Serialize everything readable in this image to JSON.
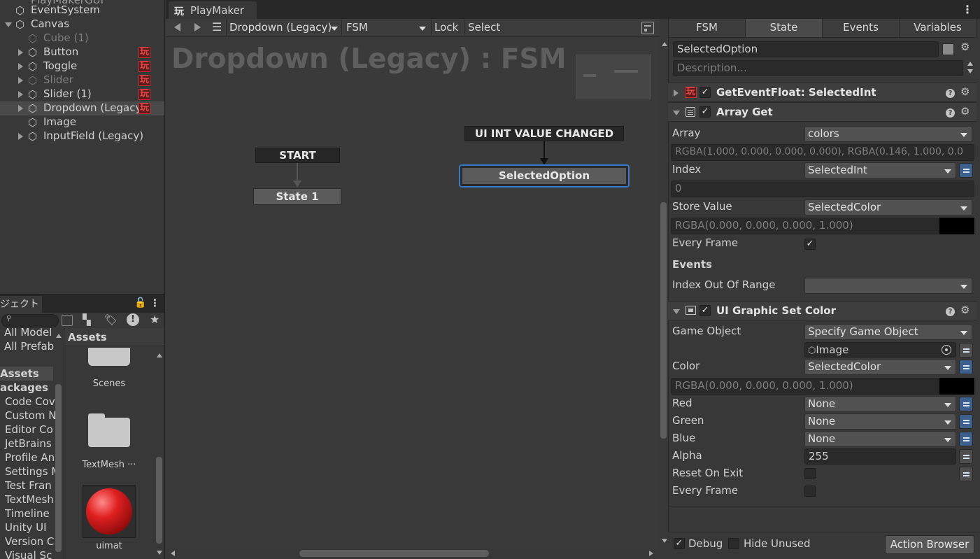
{
  "hierarchy": {
    "items": [
      {
        "label": "EventSystem",
        "indent": 0,
        "arrow": "",
        "dim": false,
        "pm": false
      },
      {
        "label": "Canvas",
        "indent": 0,
        "arrow": "down",
        "dim": false,
        "pm": false
      },
      {
        "label": "Cube (1)",
        "indent": 1,
        "arrow": "",
        "dim": true,
        "pm": false
      },
      {
        "label": "Button",
        "indent": 1,
        "arrow": "right",
        "dim": false,
        "pm": true
      },
      {
        "label": "Toggle",
        "indent": 1,
        "arrow": "right",
        "dim": false,
        "pm": true
      },
      {
        "label": "Slider",
        "indent": 1,
        "arrow": "right",
        "dim": true,
        "pm": true
      },
      {
        "label": "Slider (1)",
        "indent": 1,
        "arrow": "right",
        "dim": false,
        "pm": true
      },
      {
        "label": "Dropdown (Legacy)",
        "indent": 1,
        "arrow": "right",
        "dim": false,
        "pm": true
      },
      {
        "label": "Image",
        "indent": 1,
        "arrow": "",
        "dim": false,
        "pm": false
      },
      {
        "label": "InputField (Legacy)",
        "indent": 1,
        "arrow": "right",
        "dim": false,
        "pm": false
      }
    ],
    "pm_glyph": "玩"
  },
  "project": {
    "tab_label": "ジェクト",
    "search_icon": "🔍",
    "favorites": [
      "All Model",
      "All Prefab"
    ],
    "tree": [
      "Assets",
      "ackages",
      "Code Cov",
      "Custom N",
      "Editor Co",
      "JetBrains",
      "Profile An",
      "Settings M",
      "Test Fran",
      "TextMesh",
      "Timeline",
      "Unity UI",
      "Version C",
      "Visual Sc"
    ],
    "assets_header": "Assets",
    "assets": [
      "Scenes",
      "TextMesh ···",
      "uimat"
    ]
  },
  "playmaker": {
    "window_title": "PlayMaker",
    "fsm_owner": "Dropdown (Legacy)",
    "fsm_name": "FSM",
    "lock_label": "Lock",
    "select_label": "Select",
    "graph_title": "Dropdown (Legacy) : FSM",
    "start_label": "START",
    "state1_label": "State 1",
    "event_label": "UI INT VALUE CHANGED",
    "selected_state_label": "SelectedOption"
  },
  "inspector": {
    "tabs": [
      "FSM",
      "State",
      "Events",
      "Variables"
    ],
    "active_tab": "State",
    "state_name": "SelectedOption",
    "description_placeholder": "Description...",
    "action1_title": "GetEventFloat: SelectedInt",
    "action2_title": "Array Get",
    "array_label": "Array",
    "array_value": "colors",
    "array_preview": "RGBA(1.000, 0.000, 0.000, 0.000), RGBA(0.146, 1.000, 0.0",
    "index_label": "Index",
    "index_value": "SelectedInt",
    "index_preview": "0",
    "store_label": "Store Value",
    "store_value": "SelectedColor",
    "store_preview": "RGBA(0.000, 0.000, 0.000, 1.000)",
    "every_frame_label": "Every Frame",
    "events_label": "Events",
    "index_out_label": "Index Out Of Range",
    "action3_title": "UI Graphic Set Color",
    "go_label": "Game Object",
    "go_value": "Specify Game Object",
    "go_object": "Image",
    "color_label": "Color",
    "color_value": "SelectedColor",
    "color_preview": "RGBA(0.000, 0.000, 0.000, 1.000)",
    "red_label": "Red",
    "green_label": "Green",
    "blue_label": "Blue",
    "none_value": "None",
    "alpha_label": "Alpha",
    "alpha_value": "255",
    "reset_label": "Reset On Exit",
    "every_frame2_label": "Every Frame",
    "debug_label": "Debug",
    "hide_unused_label": "Hide Unused",
    "action_browser_label": "Action Browser"
  }
}
